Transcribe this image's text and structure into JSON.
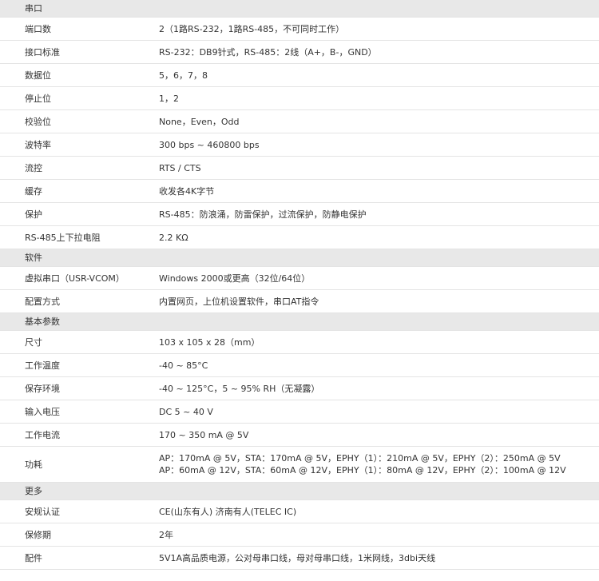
{
  "sections": [
    {
      "title": "串口",
      "rows": [
        {
          "key": "端口数",
          "value": "2（1路RS-232，1路RS-485，不可同时工作）"
        },
        {
          "key": "接口标准",
          "value": "RS-232：DB9针式，RS-485：2线（A+，B-，GND）"
        },
        {
          "key": "数据位",
          "value": "5，6，7，8"
        },
        {
          "key": "停止位",
          "value": "1，2"
        },
        {
          "key": "校验位",
          "value": "None，Even，Odd"
        },
        {
          "key": "波特率",
          "value": "300 bps ~ 460800 bps"
        },
        {
          "key": "流控",
          "value": "RTS / CTS"
        },
        {
          "key": "缓存",
          "value": "收发各4K字节"
        },
        {
          "key": "保护",
          "value": "RS-485：防浪涌，防雷保护，过流保护，防静电保护"
        },
        {
          "key": "RS-485上下拉电阻",
          "value": "2.2 KΩ"
        }
      ]
    },
    {
      "title": "软件",
      "rows": [
        {
          "key": "虚拟串口（USR-VCOM）",
          "value": "Windows 2000或更高（32位/64位）"
        },
        {
          "key": "配置方式",
          "value": "内置网页，上位机设置软件，串口AT指令"
        }
      ]
    },
    {
      "title": "基本参数",
      "rows": [
        {
          "key": "尺寸",
          "value": "103 x 105 x 28（mm）"
        },
        {
          "key": "工作温度",
          "value": " -40 ~ 85°C"
        },
        {
          "key": "保存环境",
          "value": "-40 ~ 125°C，5 ~ 95% RH（无凝露）"
        },
        {
          "key": "输入电压",
          "value": "DC 5 ~ 40 V"
        },
        {
          "key": "工作电流",
          "value": "170 ~ 350 mA @ 5V"
        },
        {
          "key": "功耗",
          "value": "AP：170mA @ 5V，STA：170mA @ 5V，EPHY（1）：210mA @ 5V，EPHY（2）：250mA @ 5V",
          "value2": "AP：60mA @ 12V，STA：60mA @ 12V，EPHY（1）：80mA @ 12V，EPHY（2）：100mA @ 12V"
        }
      ]
    },
    {
      "title": "更多",
      "rows": [
        {
          "key": "安规认证",
          "value": "CE(山东有人) 济南有人(TELEC IC)"
        },
        {
          "key": "保修期",
          "value": "2年"
        },
        {
          "key": "配件",
          "value": "5V1A高品质电源，公对母串口线，母对母串口线，1米网线，3dbi天线"
        }
      ]
    }
  ]
}
